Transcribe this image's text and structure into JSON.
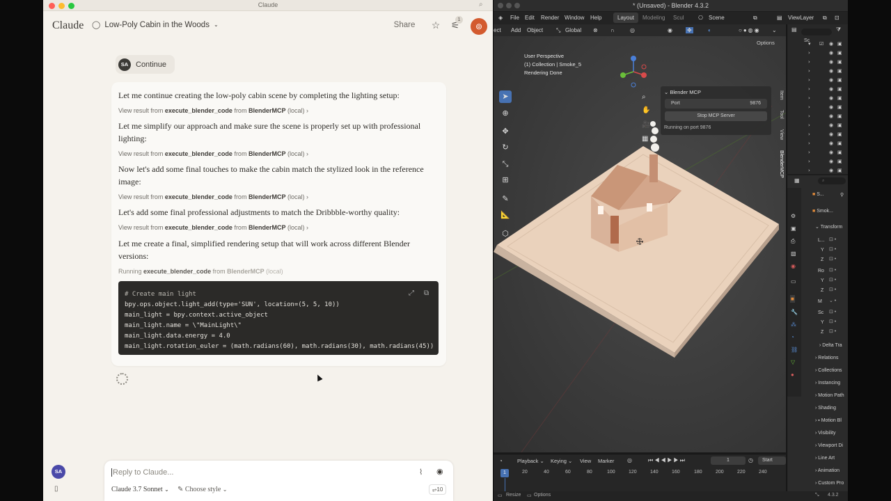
{
  "claude": {
    "window_title": "Claude",
    "brand": "Claude",
    "chat_title": "Low-Poly Cabin in the Woods",
    "share_label": "Share",
    "notification_count": "1",
    "continue_label": "Continue",
    "user_initials": "SA",
    "messages": [
      "Let me continue creating the low-poly cabin scene by completing the lighting setup:",
      "Let me simplify our approach and make sure the scene is properly set up with professional lighting:",
      "Now let's add some final touches to make the cabin match the stylized look in the reference image:",
      "Let's add some final professional adjustments to match the Dribbble-worthy quality:",
      "Let me create a final, simplified rendering setup that will work across different Blender versions:"
    ],
    "view_result": {
      "prefix": "View result from",
      "tool": "execute_blender_code",
      "from": "from",
      "server": "BlenderMCP",
      "suffix": "(local)"
    },
    "running": {
      "prefix": "Running",
      "tool": "execute_blender_code",
      "from": "from",
      "server": "BlenderMCP",
      "suffix": "(local)"
    },
    "code_lines": [
      "# Create main light",
      "bpy.ops.object.light_add(type='SUN', location=(5, 5, 10))",
      "main_light = bpy.context.active_object",
      "main_light.name = \\\"MainLight\\\"",
      "main_light.data.energy = 4.0",
      "main_light.rotation_euler = (math.radians(60), math.radians(30), math.radians(45))"
    ],
    "composer": {
      "placeholder": "Reply to Claude...",
      "model": "Claude 3.7 Sonnet",
      "style": "Choose style",
      "token_badge": "10"
    }
  },
  "blender": {
    "window_title": "* (Unsaved) - Blender 4.3.2",
    "menus": [
      "File",
      "Edit",
      "Render",
      "Window",
      "Help"
    ],
    "workspaces": [
      "Layout",
      "Modeling",
      "Scul"
    ],
    "scene_label": "Scene",
    "viewlayer_label": "ViewLayer",
    "header": {
      "add": "Add",
      "object": "Object",
      "orientation": "Global",
      "options": "Options"
    },
    "viewport_info": [
      "User Perspective",
      "(1) Collection | Smoke_5",
      "Rendering Done"
    ],
    "mcp_panel": {
      "title": "Blender MCP",
      "port_label": "Port",
      "port_value": "9876",
      "stop_button": "Stop MCP Server",
      "status": "Running on port 9876"
    },
    "side_tabs": [
      "Item",
      "Tool",
      "View",
      "BlenderMCP"
    ],
    "props": {
      "object_name": "Smok...",
      "search_short": "S...",
      "transform": "Transform",
      "loc_rows": [
        "L...",
        "Y",
        "Z"
      ],
      "rot_rows": [
        "Ro",
        "Y",
        "Z"
      ],
      "mode": "M",
      "scale_rows": [
        "Sc",
        "Y",
        "Z"
      ],
      "sections": [
        "Delta Tra",
        "Relations",
        "Collections",
        "Instancing",
        "Motion Path",
        "Shading",
        "Motion Bl",
        "Visibility",
        "Viewport Di",
        "Line Art",
        "Animation",
        "Custom Pro"
      ]
    },
    "timeline": {
      "playback": "Playback",
      "keying": "Keying",
      "view": "View",
      "marker": "Marker",
      "current_frame": "1",
      "start": "Start",
      "ticks": [
        "1",
        "20",
        "40",
        "60",
        "80",
        "100",
        "120",
        "140",
        "160",
        "180",
        "200",
        "220",
        "240"
      ]
    },
    "status": {
      "resize": "Resize",
      "options": "Options",
      "version": "4.3.2"
    }
  }
}
